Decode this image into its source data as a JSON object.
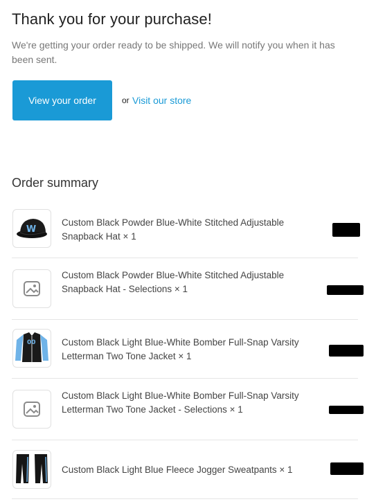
{
  "header": {
    "title": "Thank you for your purchase!",
    "subtitle": "We're getting your order ready to be shipped. We will notify you when it has been sent."
  },
  "actions": {
    "view_order_label": "View your order",
    "or_text": "or",
    "visit_store_label": "Visit our store"
  },
  "summary": {
    "title": "Order summary",
    "items": [
      {
        "name": "Custom Black Powder Blue-White Stitched Adjustable Snapback Hat × 1",
        "thumb": "hat-image"
      },
      {
        "name": "Custom Black Powder Blue-White Stitched Adjustable Snapback Hat - Selections × 1",
        "thumb": "image-placeholder-icon"
      },
      {
        "name": "Custom Black Light Blue-White Bomber Full-Snap Varsity Letterman Two Tone Jacket × 1",
        "thumb": "jacket-image"
      },
      {
        "name": "Custom Black Light Blue-White Bomber Full-Snap Varsity Letterman Two Tone Jacket - Selections × 1",
        "thumb": "image-placeholder-icon"
      },
      {
        "name": "Custom Black Light Blue Fleece Jogger Sweatpants × 1",
        "thumb": "sweatpants-image"
      }
    ]
  },
  "colors": {
    "accent": "#1a9ad6",
    "redaction": "#000000"
  }
}
